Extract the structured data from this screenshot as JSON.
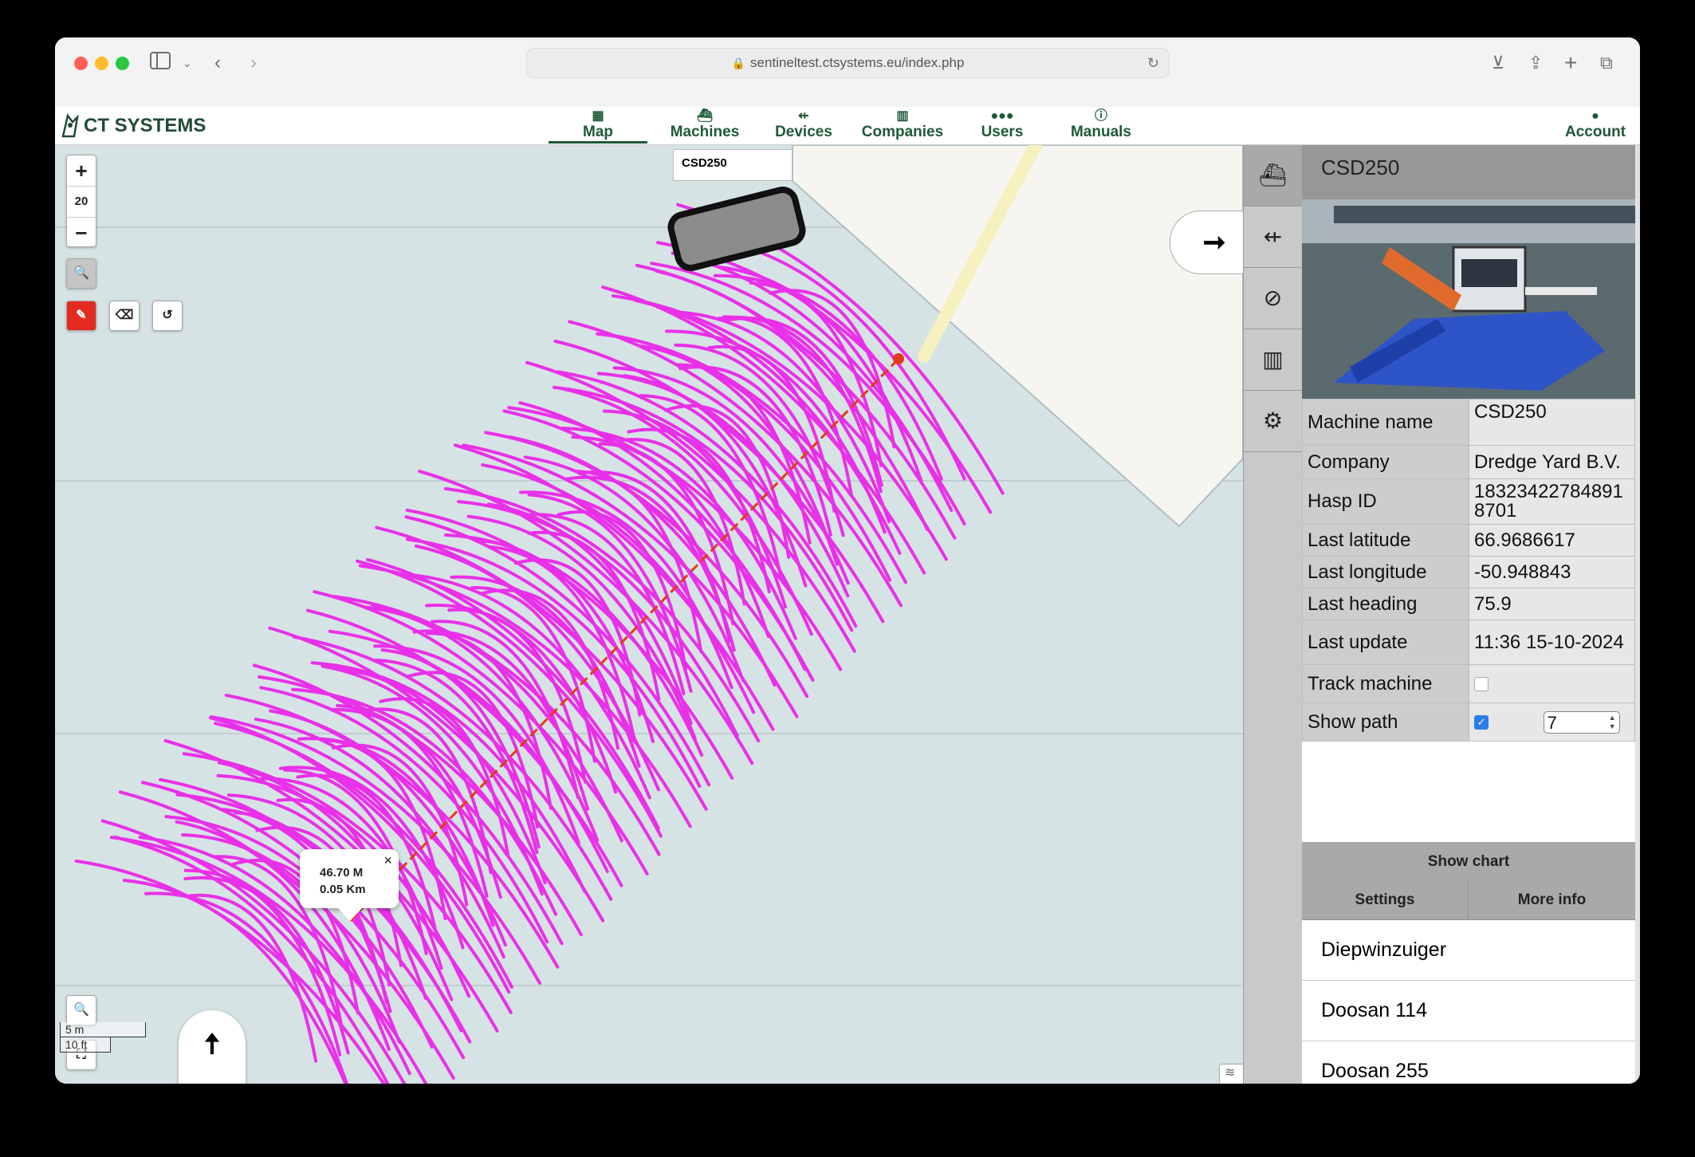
{
  "browser": {
    "url": "sentineltest.ctsystems.eu/index.php"
  },
  "brand": "CT SYSTEMS",
  "nav": [
    {
      "label": "Map",
      "icon": "map-icon",
      "active": true
    },
    {
      "label": "Machines",
      "icon": "ship-icon",
      "active": false
    },
    {
      "label": "Devices",
      "icon": "usb-icon",
      "active": false
    },
    {
      "label": "Companies",
      "icon": "building-icon",
      "active": false
    },
    {
      "label": "Users",
      "icon": "users-icon",
      "active": false
    },
    {
      "label": "Manuals",
      "icon": "info-icon",
      "active": false
    }
  ],
  "account_label": "Account",
  "map": {
    "zoom_level": "20",
    "machine_label": "CSD250",
    "measure": {
      "meters": "46.70 M",
      "km": "0.05 Km"
    },
    "scale": {
      "metric": "5 m",
      "imperial": "10 ft"
    },
    "track_color": "#e930e9"
  },
  "panel": {
    "title": "CSD250",
    "fields": [
      {
        "key": "Machine name",
        "value": "CSD250"
      },
      {
        "key": "Company",
        "value": "Dredge Yard B.V."
      },
      {
        "key": "Hasp ID",
        "value": "183234227848918701"
      },
      {
        "key": "Last latitude",
        "value": "66.9686617"
      },
      {
        "key": "Last longitude",
        "value": "-50.948843"
      },
      {
        "key": "Last heading",
        "value": "75.9"
      },
      {
        "key": "Last update",
        "value": "11:36 15-10-2024"
      }
    ],
    "track_machine": {
      "label": "Track machine",
      "checked": false
    },
    "show_path": {
      "label": "Show path",
      "checked": true,
      "value": "7"
    },
    "show_chart": "Show chart",
    "settings": "Settings",
    "more_info": "More info",
    "machines": [
      "Diepwinzuiger",
      "Doosan 114",
      "Doosan 255"
    ]
  }
}
